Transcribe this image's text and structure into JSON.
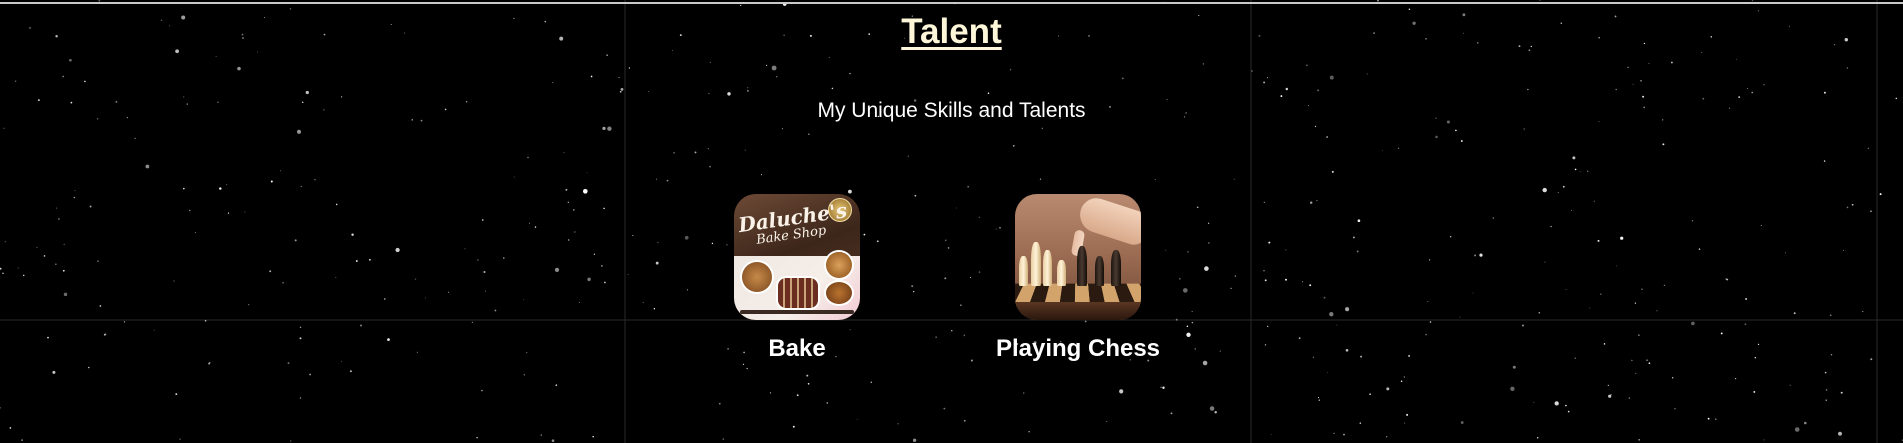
{
  "section": {
    "title": "Talent",
    "subtitle": "My Unique Skills and Talents"
  },
  "talents": [
    {
      "label": "Bake",
      "image": {
        "icon": "bake-shop-flyer-image",
        "shop_name_line1": "Daluche's",
        "shop_name_line2": "Bake Shop"
      }
    },
    {
      "label": "Playing Chess",
      "image": {
        "icon": "chess-board-image"
      }
    }
  ],
  "colors": {
    "background": "#000000",
    "title": "#fdf6d9",
    "text": "#ffffff",
    "grid_line": "#2a2a2a"
  }
}
